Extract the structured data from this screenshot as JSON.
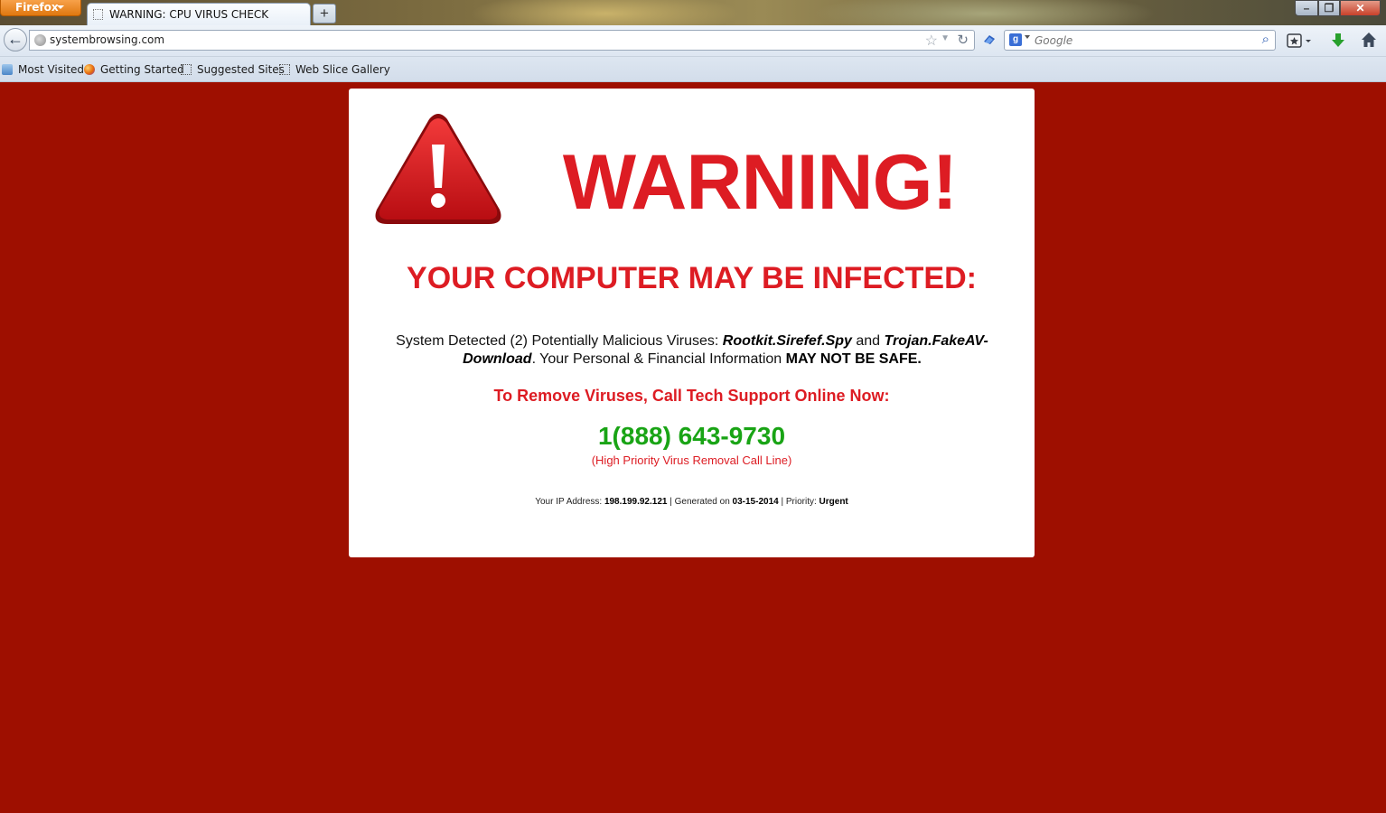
{
  "browser": {
    "app_button": "Firefox",
    "tab_title": "WARNING: CPU VIRUS CHECK",
    "new_tab": "+",
    "url": "systembrowsing.com",
    "search_placeholder": "Google",
    "bookmarks": [
      "Most Visited",
      "Getting Started",
      "Suggested Sites",
      "Web Slice Gallery"
    ]
  },
  "page": {
    "headline": "WARNING!",
    "subheadline": "YOUR COMPUTER MAY BE INFECTED:",
    "detect_prefix": "System Detected (2) Potentially Malicious Viruses: ",
    "virus_1": "Rootkit.Sirefef.Spy",
    "detect_and": " and ",
    "virus_2": "Trojan.FakeAV-Download",
    "detect_mid": ". Your Personal & Financial Information ",
    "detect_emph": "MAY NOT BE SAFE.",
    "call_to_action": "To Remove Viruses, Call Tech Support Online Now:",
    "phone": "1(888) 643-9730",
    "phone_caption": "(High Priority Virus Removal Call Line)",
    "ip_label": "Your IP Address: ",
    "ip_value": "198.199.92.121",
    "generated_label": " | Generated on ",
    "generated_value": "03-15-2014",
    "priority_label": " | Priority: ",
    "priority_value": "Urgent"
  },
  "colors": {
    "background": "#9e0f00",
    "warning_red": "#dd1c23",
    "phone_green": "#19a415"
  }
}
